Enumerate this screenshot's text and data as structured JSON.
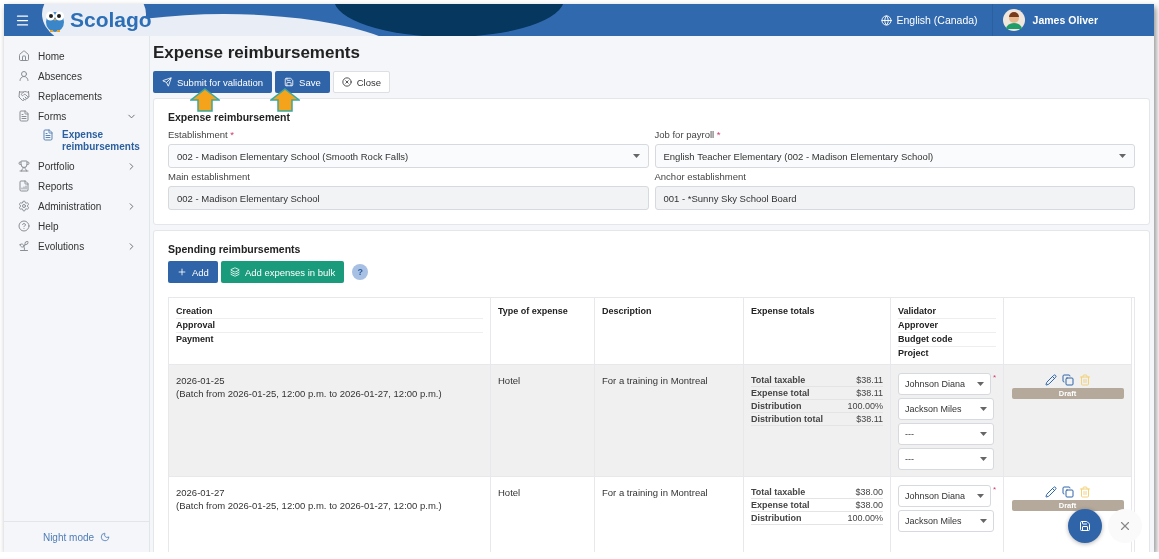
{
  "header": {
    "logo": "Scolago",
    "language": "English (Canada)",
    "user": "James Oliver"
  },
  "sidebar": {
    "items": [
      {
        "label": "Home",
        "selected": false
      },
      {
        "label": "Absences",
        "selected": false
      },
      {
        "label": "Replacements",
        "selected": false
      },
      {
        "label": "Forms",
        "selected": false,
        "expanded": true,
        "children": [
          {
            "label": "Expense reimbursements",
            "selected": true
          }
        ]
      },
      {
        "label": "Portfolio",
        "selected": false,
        "expanded": false
      },
      {
        "label": "Reports",
        "selected": false
      },
      {
        "label": "Administration",
        "selected": false,
        "expanded": false
      },
      {
        "label": "Help",
        "selected": false
      },
      {
        "label": "Evolutions",
        "selected": false,
        "expanded": false
      }
    ],
    "footer": "Night mode"
  },
  "page": {
    "title": "Expense reimbursements",
    "actions": [
      {
        "label": "Submit for validation",
        "kind": "primary"
      },
      {
        "label": "Save",
        "kind": "primary"
      },
      {
        "label": "Close",
        "kind": "secondary"
      }
    ]
  },
  "form": {
    "title": "Expense reimbursement",
    "required_mark": "*",
    "fields": [
      {
        "label": "Establishment",
        "required": true,
        "kind": "select",
        "value": "002 - Madison Elementary School (Smooth Rock Falls)"
      },
      {
        "label": "Job for payroll",
        "required": true,
        "kind": "select",
        "value": "English Teacher Elementary (002 - Madison Elementary School)"
      },
      {
        "label": "Main establishment",
        "required": false,
        "kind": "readonly",
        "value": "002 - Madison Elementary School"
      },
      {
        "label": "Anchor establishment",
        "required": false,
        "kind": "readonly",
        "value": "001 - *Sunny Sky School Board"
      }
    ]
  },
  "spending": {
    "title": "Spending reimbursements",
    "required_mark": "*",
    "add": "Add",
    "bulk": "Add expenses in bulk",
    "help": "?",
    "columns": [
      [
        "Creation",
        "Approval",
        "Payment"
      ],
      [
        "Type of expense"
      ],
      [
        "Description"
      ],
      [
        "Expense totals"
      ],
      [
        "Validator",
        "Approver",
        "Budget code",
        "Project"
      ]
    ],
    "rows": [
      {
        "highlighted": true,
        "date": "2026-01-25",
        "batch": "(Batch from 2026-01-25, 12:00 p.m. to 2026-01-27, 12:00 p.m.)",
        "type": "Hotel",
        "description": "For a training in Montreal",
        "totals": [
          {
            "label": "Total taxable",
            "value": "$38.11"
          },
          {
            "label": "Expense total",
            "value": "$38.11"
          },
          {
            "label": "Distribution",
            "value": "100.00%"
          },
          {
            "label": "Distribution total",
            "value": "$38.11"
          }
        ],
        "people": [
          {
            "value": "Johnson Diana",
            "required": true
          },
          {
            "value": "Jackson Miles",
            "required": false
          },
          {
            "value": "---",
            "required": false
          },
          {
            "value": "---",
            "required": false
          }
        ],
        "status": "Draft"
      },
      {
        "highlighted": false,
        "date": "2026-01-27",
        "batch": "(Batch from 2026-01-25, 12:00 p.m. to 2026-01-27, 12:00 p.m.)",
        "type": "Hotel",
        "description": "For a training in Montreal",
        "totals": [
          {
            "label": "Total taxable",
            "value": "$38.00"
          },
          {
            "label": "Expense total",
            "value": "$38.00"
          },
          {
            "label": "Distribution",
            "value": "100.00%"
          }
        ],
        "people": [
          {
            "value": "Johnson Diana",
            "required": true
          },
          {
            "value": "Jackson Miles",
            "required": false
          }
        ],
        "status": "Draft"
      }
    ]
  }
}
